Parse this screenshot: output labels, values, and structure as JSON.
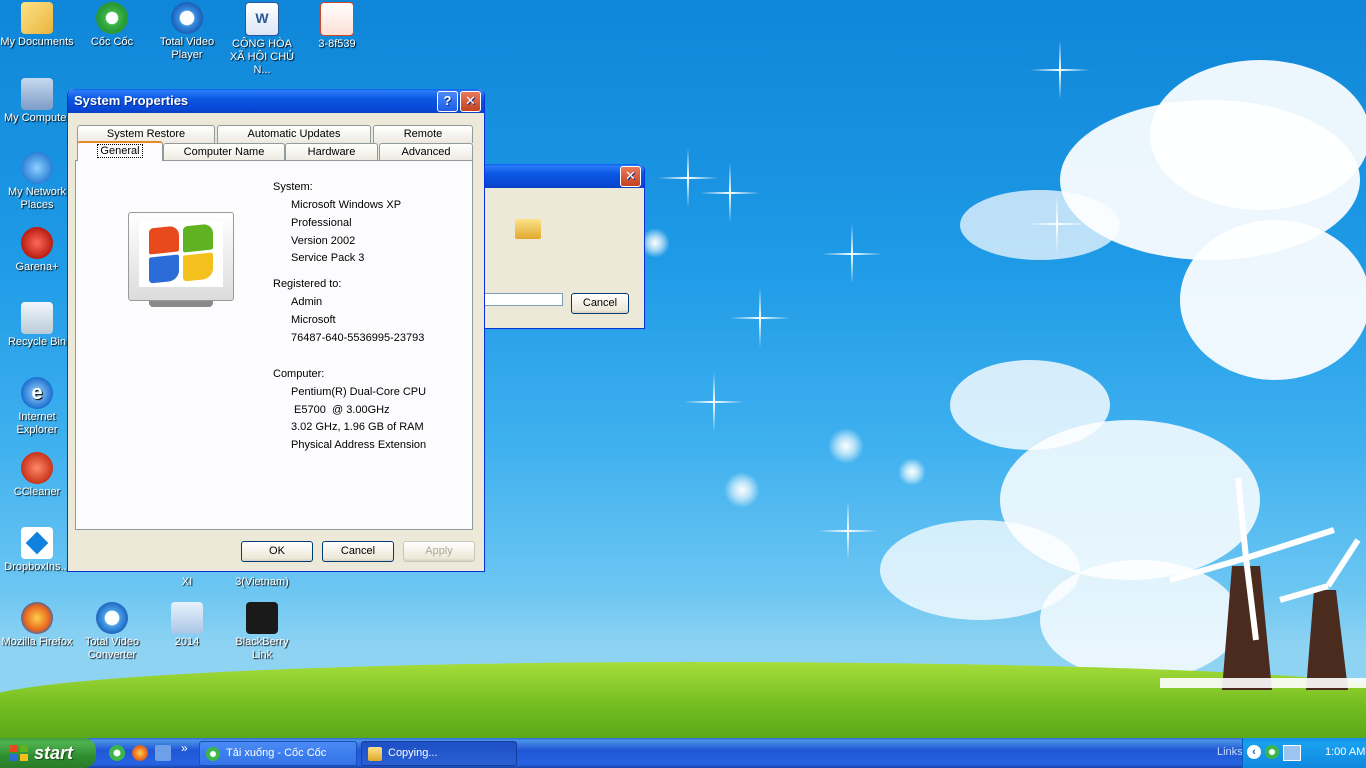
{
  "desktop": {
    "icons": [
      {
        "label": "My Documents",
        "icon": "folder-documents-icon"
      },
      {
        "label": "Cốc Cốc",
        "icon": "coccoc-browser-icon"
      },
      {
        "label": "Total Video Player",
        "icon": "video-player-icon"
      },
      {
        "label": "CỘNG HÒA XÃ HỘI CHỦ N...",
        "icon": "word-document-icon"
      },
      {
        "label": "3-8f539",
        "icon": "powerpoint-icon"
      },
      {
        "label": "My Computer",
        "icon": "computer-icon"
      },
      {
        "label": "My Network Places",
        "icon": "network-icon"
      },
      {
        "label": "Garena+",
        "icon": "garena-icon"
      },
      {
        "label": "Recycle Bin",
        "icon": "recycle-bin-icon"
      },
      {
        "label": "Internet Explorer",
        "icon": "internet-explorer-icon"
      },
      {
        "label": "CCleaner",
        "icon": "ccleaner-icon"
      },
      {
        "label": "DropboxIns...",
        "icon": "dropbox-icon"
      },
      {
        "label": "XI",
        "icon": "document-icon"
      },
      {
        "label": "3(Vietnam)",
        "icon": "document-icon"
      },
      {
        "label": "Mozilla Firefox",
        "icon": "firefox-icon"
      },
      {
        "label": "Total Video Converter",
        "icon": "video-converter-icon"
      },
      {
        "label": "2014",
        "icon": "folder-icon"
      },
      {
        "label": "BlackBerry Link",
        "icon": "blackberry-icon"
      }
    ]
  },
  "system_properties": {
    "title": "System Properties",
    "tabs_row1": [
      "System Restore",
      "Automatic Updates",
      "Remote"
    ],
    "tabs_row2": [
      "General",
      "Computer Name",
      "Hardware",
      "Advanced"
    ],
    "active_tab": "General",
    "system_label": "System:",
    "system_lines": [
      "Microsoft Windows XP",
      "Professional",
      "Version 2002",
      "Service Pack 3"
    ],
    "registered_label": "Registered to:",
    "registered_lines": [
      "Admin",
      "Microsoft",
      "76487-640-5536995-23793"
    ],
    "computer_label": "Computer:",
    "computer_lines": [
      "Pentium(R) Dual-Core  CPU",
      " E5700  @ 3.00GHz",
      "3.02 GHz, 1.96 GB of RAM",
      "Physical Address Extension"
    ],
    "ok": "OK",
    "cancel": "Cancel",
    "apply": "Apply"
  },
  "copy_dialog": {
    "cancel": "Cancel"
  },
  "taskbar": {
    "start_label": "start",
    "tasks": [
      {
        "label": "Tải xuống - Cốc Cốc",
        "icon": "coccoc-browser-icon"
      },
      {
        "label": "Copying...",
        "icon": "folder-icon"
      }
    ],
    "links_label": "Links",
    "clock": "1:00 AM"
  }
}
